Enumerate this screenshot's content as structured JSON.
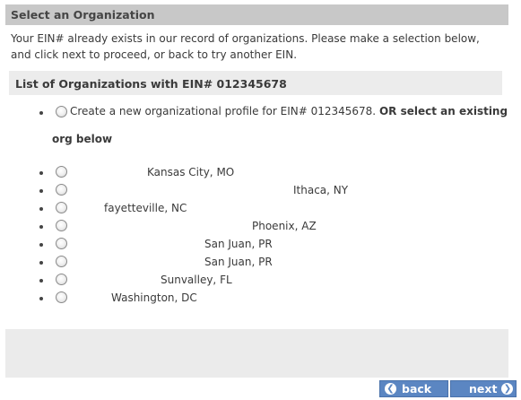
{
  "header": {
    "title": "Select an Organization"
  },
  "intro": {
    "text": "Your EIN# already exists in our record of organizations. Please make a selection below, and click next to proceed, or back to try another EIN."
  },
  "list": {
    "heading": "List of Organizations with EIN# 012345678",
    "create_option": {
      "text": "Create a new organizational profile for EIN# 012345678.",
      "bold_text": "OR select an existing",
      "bold_text_line2": "org below"
    },
    "organizations": [
      {
        "location": "Kansas City, MO"
      },
      {
        "location": "Ithaca, NY"
      },
      {
        "location": "fayetteville, NC"
      },
      {
        "location": "Phoenix, AZ"
      },
      {
        "location": "San Juan, PR"
      },
      {
        "location": "San Juan, PR"
      },
      {
        "location": "Sunvalley, FL"
      },
      {
        "location": "Washington, DC"
      }
    ]
  },
  "nav": {
    "back_label": "back",
    "next_label": "next",
    "back_icon": "arrow-left-icon",
    "next_icon": "arrow-right-icon"
  },
  "colors": {
    "header_bg": "#c8c8c8",
    "list_header_bg": "#ececec",
    "button_bg": "#5b86c2"
  }
}
